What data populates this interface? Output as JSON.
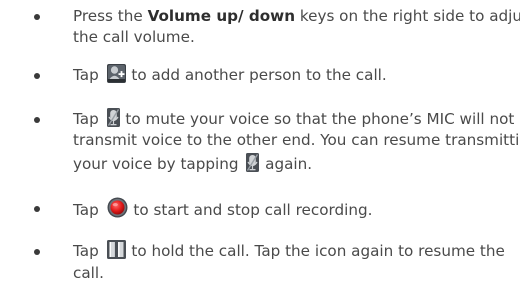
{
  "items": [
    {
      "pre": "Press the ",
      "bold": "Volume up/ down",
      "post": " keys on the right side to adjust",
      "line2": "the call volume."
    },
    {
      "pre": "Tap ",
      "icon": "add-person-icon",
      "post": " to add another person to the call."
    },
    {
      "pre": "Tap ",
      "icon": "mute-mic-icon",
      "post": " to mute your voice so that the phone’s MIC will not",
      "line2": "transmit voice to the other end. You can resume transmitting",
      "line3_pre": "your voice by tapping ",
      "line3_post": " again."
    },
    {
      "pre": "Tap ",
      "icon": "record-icon",
      "post": " to start and stop call recording."
    },
    {
      "pre": "Tap ",
      "icon": "hold-icon",
      "post": " to hold the call. Tap the icon again to resume the",
      "line2": "call."
    }
  ],
  "colors": {
    "text": "#4a4a4a",
    "record_red": "#e41b1b"
  }
}
